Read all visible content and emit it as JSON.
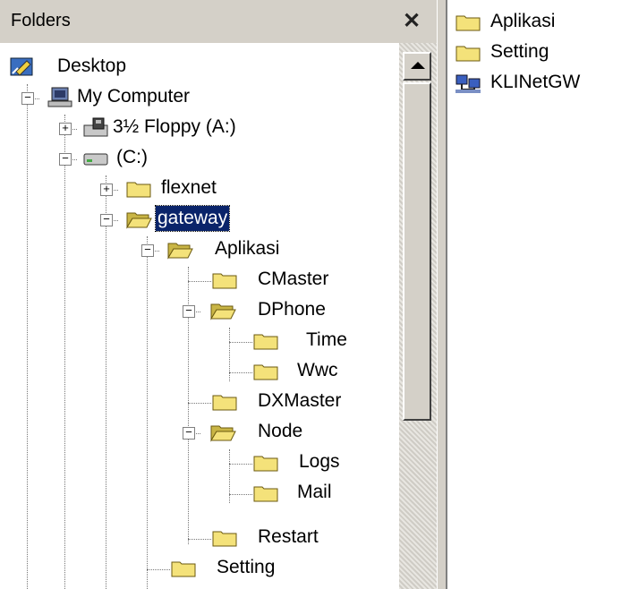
{
  "folders_panel": {
    "title": "Folders",
    "close_symbol": "✕"
  },
  "tree": [
    {
      "label": "Desktop",
      "icon": "desktop-icon"
    },
    {
      "label": "My Computer",
      "icon": "computer-icon"
    },
    {
      "label": "3½ Floppy (A:)",
      "icon": "floppy-drive-icon"
    },
    {
      "label": "(C:)",
      "icon": "hard-drive-icon"
    },
    {
      "label": "flexnet",
      "icon": "folder-icon"
    },
    {
      "label": "gateway",
      "icon": "open-folder-icon",
      "selected": true
    },
    {
      "label": "Aplikasi",
      "icon": "open-folder-icon"
    },
    {
      "label": "CMaster",
      "icon": "folder-icon"
    },
    {
      "label": "DPhone",
      "icon": "open-folder-icon"
    },
    {
      "label": "Time",
      "icon": "folder-icon"
    },
    {
      "label": "Wwc",
      "icon": "folder-icon"
    },
    {
      "label": "DXMaster",
      "icon": "folder-icon"
    },
    {
      "label": "Node",
      "icon": "open-folder-icon"
    },
    {
      "label": "Logs",
      "icon": "folder-icon"
    },
    {
      "label": "Mail",
      "icon": "folder-icon"
    },
    {
      "label": "Restart",
      "icon": "folder-icon"
    },
    {
      "label": "Setting",
      "icon": "folder-icon"
    }
  ],
  "expanders": {
    "plus": "+",
    "minus": "−"
  },
  "contents": [
    {
      "label": "Aplikasi",
      "icon": "folder-icon"
    },
    {
      "label": "Setting",
      "icon": "folder-icon"
    },
    {
      "label": "KLINetGW",
      "icon": "network-share-icon"
    }
  ],
  "colors": {
    "selection": "#0a246a",
    "folder_yellow": "#f4e27a",
    "chrome": "#d4d0c8"
  }
}
